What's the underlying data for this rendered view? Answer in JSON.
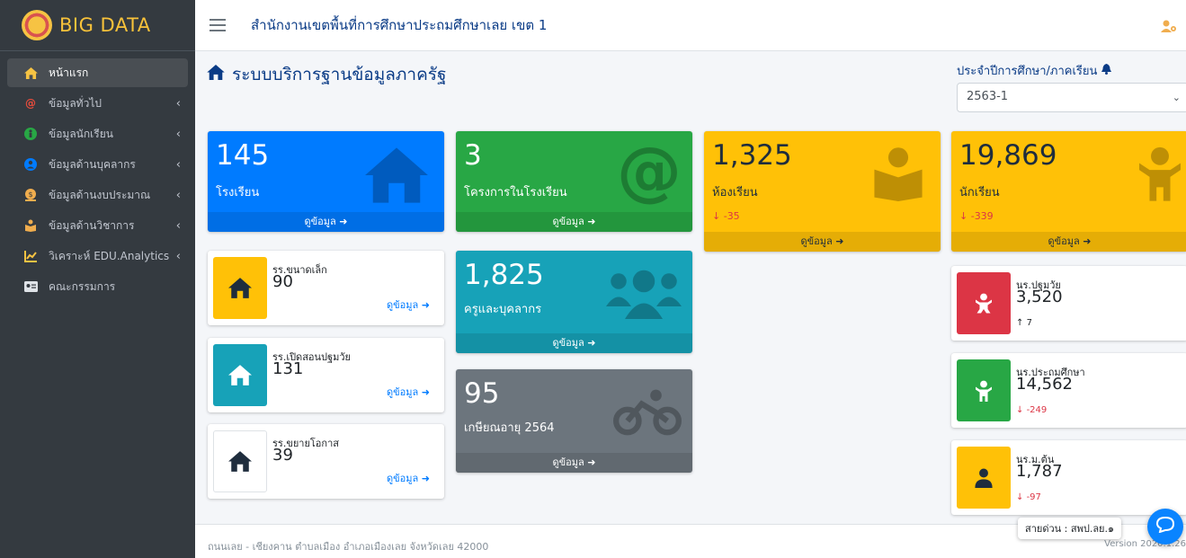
{
  "brand": {
    "name": "BIG DATA"
  },
  "sidebar": {
    "items": [
      {
        "label": "หน้าแรก",
        "icon": "home-icon",
        "color": "#f6c343"
      },
      {
        "label": "ข้อมูลทั่วไป",
        "icon": "at-icon",
        "color": "#e74c3c"
      },
      {
        "label": "ข้อมูลนักเรียน",
        "icon": "child-icon",
        "color": "#28a745"
      },
      {
        "label": "ข้อมูลด้านบุคลากร",
        "icon": "user-circle-icon",
        "color": "#007bff"
      },
      {
        "label": "ข้อมูลด้านงบประมาณ",
        "icon": "money-icon",
        "color": "#f0ad4e"
      },
      {
        "label": "ข้อมูลด้านวิชาการ",
        "icon": "book-reader-icon",
        "color": "#f0ad4e"
      },
      {
        "label": "วิเคราะห์ EDU.Analytics",
        "icon": "chart-icon",
        "color": "#f6c343"
      },
      {
        "label": "คณะกรรมการ",
        "icon": "id-card-icon",
        "color": "#dfe3e8"
      }
    ]
  },
  "topbar": {
    "title": "สำนักงานเขตพื้นที่การศึกษาประถมศึกษาเลย เขต 1"
  },
  "header": {
    "title": "ระบบบริการฐานข้อมูลภาครัฐ",
    "year_label": "ประจำปีการศึกษา/ภาคเรียน",
    "year_value": "2563-1"
  },
  "more_label": "ดูข้อมูล",
  "big_boxes": {
    "schools": {
      "value": "145",
      "label": "โรงเรียน"
    },
    "projects": {
      "value": "3",
      "label": "โครงการในโรงเรียน"
    },
    "classrooms": {
      "value": "1,325",
      "label": "ห้องเรียน",
      "diff": "-35"
    },
    "students": {
      "value": "19,869",
      "label": "นักเรียน",
      "diff": "-339"
    },
    "teachers": {
      "value": "1,825",
      "label": "ครูและบุคลากร"
    },
    "retire": {
      "value": "95",
      "label": "เกษียณอายุ 2564"
    }
  },
  "school_boxes": [
    {
      "title": "รร.ขนาดเล็ก",
      "value": "90",
      "color": "#ffc107"
    },
    {
      "title": "รร.เปิดสอนปฐมวัย",
      "value": "131",
      "color": "#17a2b8"
    },
    {
      "title": "รร.ขยายโอกาส",
      "value": "39",
      "color": "#ffffff"
    }
  ],
  "student_boxes": [
    {
      "title": "นร.ปฐมวัย",
      "value": "3,520",
      "diff": "7",
      "dir": "up",
      "color": "#dc3545"
    },
    {
      "title": "นร.ประถมศึกษา",
      "value": "14,562",
      "diff": "-249",
      "dir": "down",
      "color": "#28a745"
    },
    {
      "title": "นร.ม.ต้น",
      "value": "1,787",
      "diff": "-97",
      "dir": "down",
      "color": "#ffc107"
    }
  ],
  "footer": {
    "address": "ถนนเลย - เชียงคาน ตำบลเมือง อำเภอเมืองเลย จังหวัดเลย 42000",
    "version": "Version 2020.1.26",
    "hotline": "สายด่วน : สพป.ลย.๑"
  }
}
